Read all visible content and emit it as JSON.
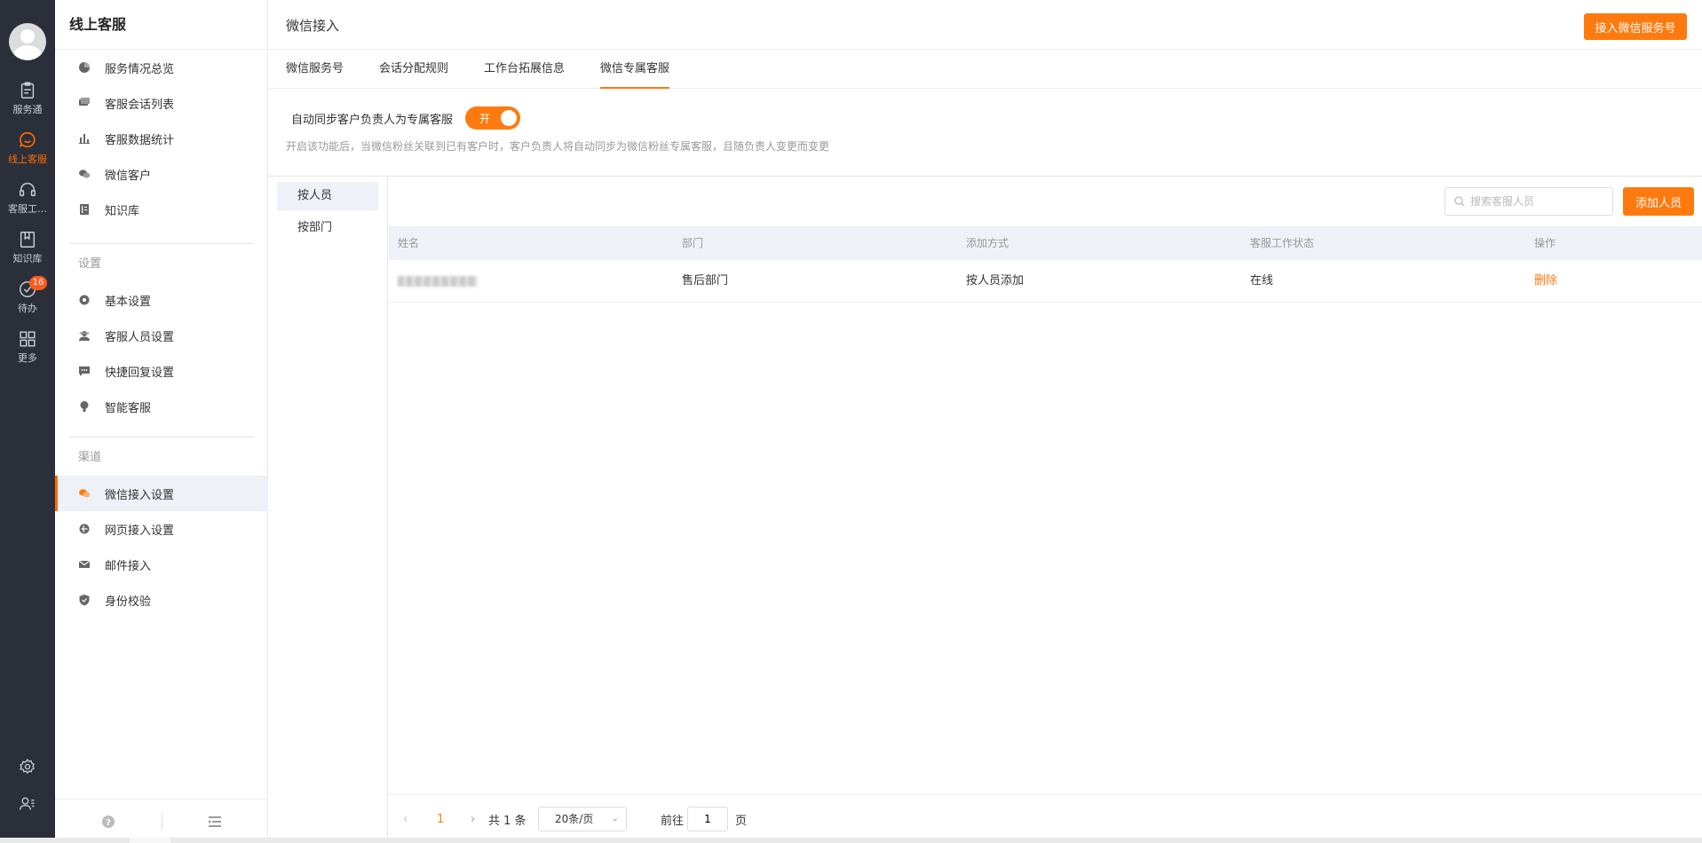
{
  "rail": {
    "items": [
      {
        "label": "服务通",
        "icon": "clipboard-icon",
        "active": false
      },
      {
        "label": "线上客服",
        "icon": "chat-smile-icon",
        "active": true
      },
      {
        "label": "客服工…",
        "icon": "headset-icon",
        "active": false
      },
      {
        "label": "知识库",
        "icon": "book-icon",
        "active": false
      },
      {
        "label": "待办",
        "icon": "check-circle-icon",
        "active": false,
        "badge": "16"
      },
      {
        "label": "更多",
        "icon": "grid-icon",
        "active": false
      }
    ],
    "bottom": [
      {
        "icon": "gear-icon"
      },
      {
        "icon": "user-list-icon"
      }
    ]
  },
  "side": {
    "title": "线上客服",
    "group1": [
      {
        "label": "服务情况总览",
        "icon": "pie-icon"
      },
      {
        "label": "客服会话列表",
        "icon": "chat-list-icon"
      },
      {
        "label": "客服数据统计",
        "icon": "bar-chart-icon"
      },
      {
        "label": "微信客户",
        "icon": "wechat-icon"
      },
      {
        "label": "知识库",
        "icon": "book-icon"
      }
    ],
    "settings_label": "设置",
    "group2": [
      {
        "label": "基本设置",
        "icon": "gear-icon"
      },
      {
        "label": "客服人员设置",
        "icon": "agent-icon"
      },
      {
        "label": "快捷回复设置",
        "icon": "message-icon"
      },
      {
        "label": "智能客服",
        "icon": "bulb-icon"
      }
    ],
    "channel_label": "渠道",
    "group3": [
      {
        "label": "微信接入设置",
        "icon": "wechat-icon",
        "active": true
      },
      {
        "label": "网页接入设置",
        "icon": "browser-icon"
      },
      {
        "label": "邮件接入",
        "icon": "mail-icon"
      },
      {
        "label": "身份校验",
        "icon": "shield-icon"
      }
    ],
    "footer": {
      "help_icon": "help-icon",
      "collapse_icon": "menu-collapse-icon"
    }
  },
  "header": {
    "title": "微信接入",
    "connect_button": "接入微信服务号"
  },
  "tabs": [
    {
      "label": "微信服务号",
      "active": false
    },
    {
      "label": "会话分配规则",
      "active": false
    },
    {
      "label": "工作台拓展信息",
      "active": false
    },
    {
      "label": "微信专属客服",
      "active": true
    }
  ],
  "sync": {
    "label": "自动同步客户负责人为专属客服",
    "toggle_text": "开",
    "enabled": true,
    "description": "开启该功能后，当微信粉丝关联到已有客户时，客户负责人将自动同步为微信粉丝专属客服，且随负责人变更而变更"
  },
  "subnav": [
    {
      "label": "按人员",
      "active": true
    },
    {
      "label": "按部门",
      "active": false
    }
  ],
  "toolbar": {
    "search_placeholder": "搜索客服人员",
    "add_button": "添加人员"
  },
  "table": {
    "columns": [
      "姓名",
      "部门",
      "添加方式",
      "客服工作状态",
      "操作"
    ],
    "rows": [
      {
        "name": "",
        "department": "售后部门",
        "method": "按人员添加",
        "status": "在线",
        "action": "删除"
      }
    ]
  },
  "pager": {
    "prev": "‹",
    "current": "1",
    "next": "›",
    "total": "共 1 条",
    "page_size": "20条/页",
    "goto_label": "前往",
    "goto_value": "1",
    "goto_unit": "页"
  },
  "colors": {
    "accent": "#ff7a0e",
    "rail_bg": "#2b2f3a",
    "active_bg": "#eef1f8"
  }
}
